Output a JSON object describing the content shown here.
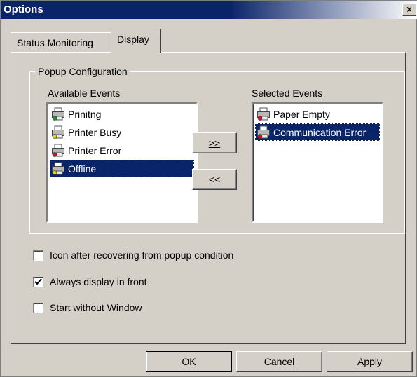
{
  "window": {
    "title": "Options",
    "close_glyph": "×"
  },
  "tabs": [
    {
      "label": "Status Monitoring",
      "active": false
    },
    {
      "label": "Display",
      "active": true
    }
  ],
  "popup_config": {
    "group_label": "Popup Configuration",
    "available_label": "Available Events",
    "selected_label": "Selected Events",
    "available_events": [
      {
        "label": "Prinitng",
        "icon": "printer-green-icon",
        "selected": false
      },
      {
        "label": "Printer Busy",
        "icon": "printer-yellow-icon",
        "selected": false
      },
      {
        "label": "Printer Error",
        "icon": "printer-red-icon",
        "selected": false
      },
      {
        "label": "Offline",
        "icon": "printer-offline-icon",
        "selected": true
      }
    ],
    "selected_events": [
      {
        "label": "Paper Empty",
        "icon": "printer-red-icon",
        "selected": false
      },
      {
        "label": "Communication Error",
        "icon": "printer-red-icon",
        "selected": true
      }
    ],
    "add_button": ">>",
    "remove_button": "<<"
  },
  "options": [
    {
      "label": "Icon after recovering from popup condition",
      "checked": false
    },
    {
      "label": "Always display in front",
      "checked": true
    },
    {
      "label": "Start without Window",
      "checked": false
    }
  ],
  "buttons": {
    "ok": "OK",
    "cancel": "Cancel",
    "apply": "Apply"
  },
  "colors": {
    "title_bar": "#0a246a",
    "selection": "#0a246a",
    "dialog_face": "#d4d0c8",
    "status_green": "#1e9a2c",
    "status_yellow": "#e8d000",
    "status_red": "#d4141c"
  }
}
